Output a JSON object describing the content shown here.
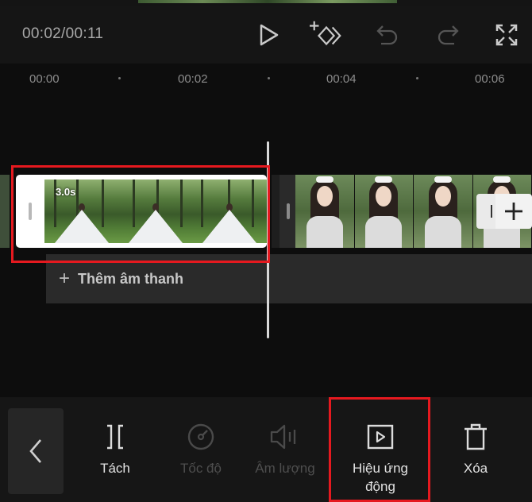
{
  "player": {
    "timecode": "00:02/00:11",
    "buttons": {
      "play": "play-icon",
      "keyframe": "add-keyframe-icon",
      "undo": "undo-icon",
      "redo": "redo-icon",
      "fullscreen": "fullscreen-icon"
    }
  },
  "ruler": {
    "ticks": [
      "00:00",
      "00:02",
      "00:04",
      "00:06"
    ]
  },
  "timeline": {
    "selected_clip": {
      "duration": "3.0s"
    },
    "audio_track": {
      "plus": "+",
      "label": "Thêm âm thanh"
    }
  },
  "toolbar": {
    "back": "chevron-left-icon",
    "tools": [
      {
        "label": "Tách",
        "icon": "split-icon",
        "enabled": true
      },
      {
        "label": "Tốc độ",
        "icon": "speed-icon",
        "enabled": false
      },
      {
        "label": "Âm lượng",
        "icon": "volume-icon",
        "enabled": false
      },
      {
        "label_line1": "Hiệu ứng",
        "label_line2": "động",
        "icon": "animation-icon",
        "enabled": true
      },
      {
        "label": "Xóa",
        "icon": "trash-icon",
        "enabled": true
      }
    ]
  },
  "colors": {
    "highlight": "#e5191f",
    "background": "#141414",
    "toolbar": "#161616",
    "audio_track": "#2a2a2a"
  }
}
